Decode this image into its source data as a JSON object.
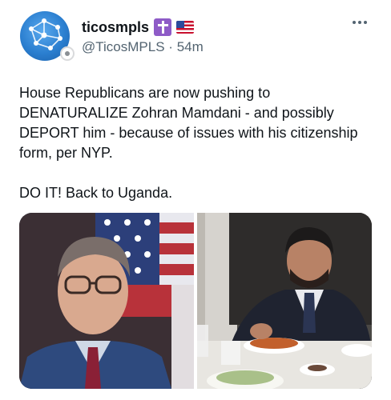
{
  "post": {
    "display_name": "ticosmpls",
    "name_badges": [
      "latin-cross-icon",
      "us-flag-icon"
    ],
    "handle": "@TicosMPLS",
    "separator": "·",
    "time": "54m",
    "text": "House Republicans are now pushing to\nDENATURALIZE Zohran Mamdani - and possibly\nDEPORT him - because of issues with his citizenship\nform, per NYP.\n\nDO IT! Back to Uganda.",
    "media": [
      {
        "icon": "photo-man-in-suit-with-flag"
      },
      {
        "icon": "photo-man-eating-at-table"
      }
    ]
  },
  "colors": {
    "text_primary": "#0f1419",
    "text_secondary": "#536471",
    "accent_avatar": "#2b7fd0"
  }
}
